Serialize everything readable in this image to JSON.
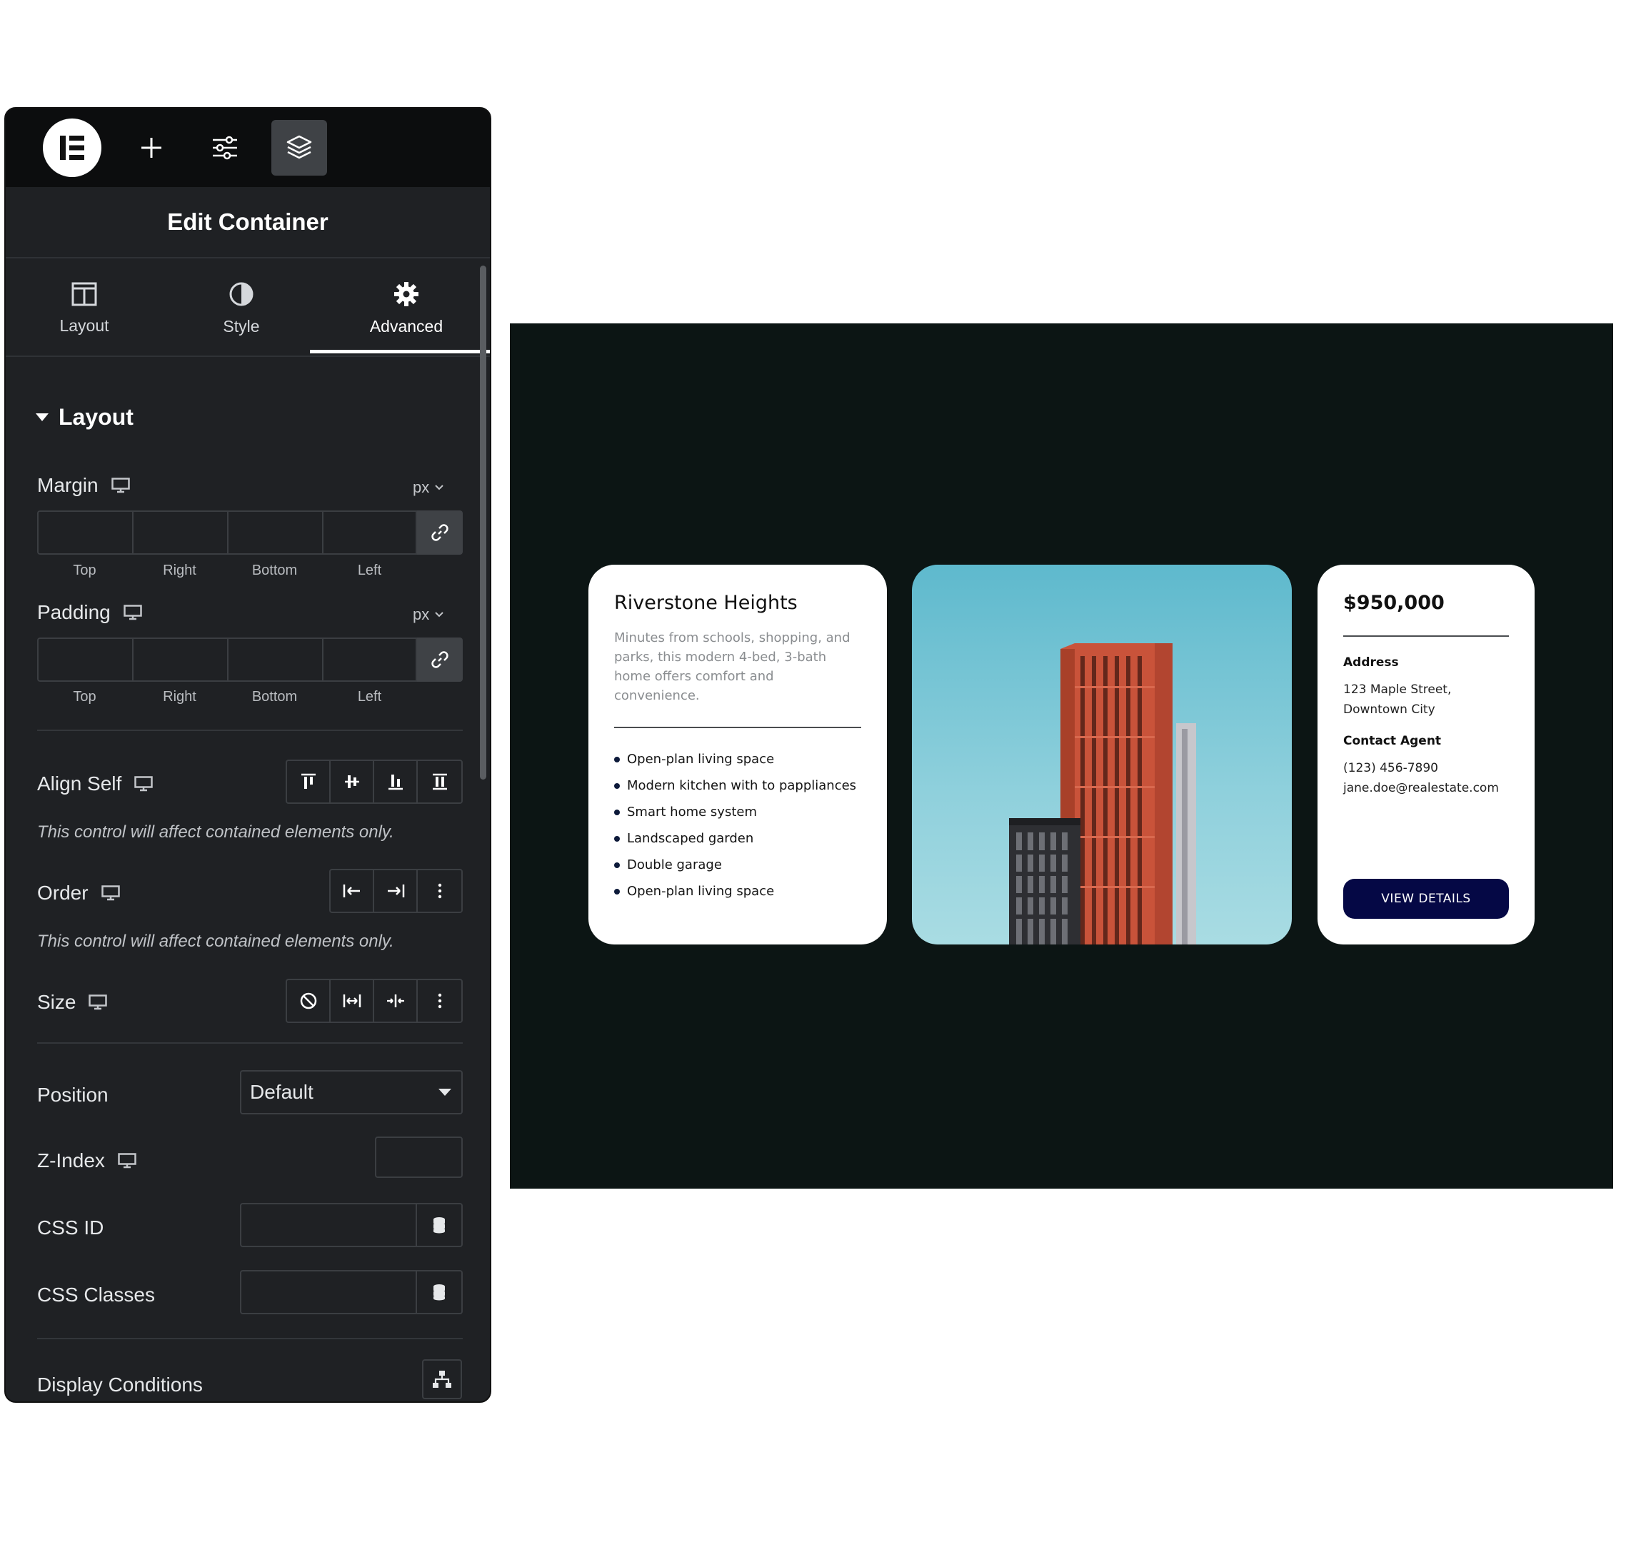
{
  "toolbar": {
    "items": [
      "elementor-logo",
      "add-element",
      "site-settings",
      "structure"
    ]
  },
  "panel": {
    "title": "Edit Container",
    "tabs": [
      {
        "label": "Layout",
        "icon": "columns-icon"
      },
      {
        "label": "Style",
        "icon": "contrast-icon"
      },
      {
        "label": "Advanced",
        "icon": "gear-icon"
      }
    ],
    "active_tab": "Advanced",
    "section": "Layout",
    "margin": {
      "label": "Margin",
      "unit": "px",
      "sides": [
        "Top",
        "Right",
        "Bottom",
        "Left"
      ]
    },
    "padding": {
      "label": "Padding",
      "unit": "px",
      "sides": [
        "Top",
        "Right",
        "Bottom",
        "Left"
      ]
    },
    "align_self": {
      "label": "Align Self",
      "hint": "This control will affect contained elements only."
    },
    "order": {
      "label": "Order",
      "hint": "This control will affect contained elements only."
    },
    "size": {
      "label": "Size"
    },
    "position": {
      "label": "Position",
      "value": "Default"
    },
    "z_index": {
      "label": "Z-Index",
      "value": ""
    },
    "css_id": {
      "label": "CSS ID",
      "value": ""
    },
    "css_classes": {
      "label": "CSS Classes",
      "value": ""
    },
    "display_conditions": {
      "label": "Display Conditions"
    }
  },
  "preview": {
    "left_card": {
      "title": "Riverstone Heights",
      "description": "Minutes from schools, shopping, and parks, this modern 4-bed, 3-bath home offers comfort and convenience.",
      "features": [
        "Open-plan living space",
        "Modern kitchen with to pappliances",
        "Smart home system",
        "Landscaped garden",
        "Double garage",
        "Open-plan living space"
      ]
    },
    "right_card": {
      "price": "$950,000",
      "address_label": "Address",
      "address_line1": "123 Maple Street,",
      "address_line2": "Downtown City",
      "agent_label": "Contact Agent",
      "agent_phone": "(123) 456-7890",
      "agent_email": "jane.doe@realestate.com",
      "button": "VIEW DETAILS"
    }
  },
  "colors": {
    "panel_bg": "#1f2124",
    "topbar_bg": "#0c0d0e",
    "preview_bg": "#0c1514",
    "button_bg": "#050845",
    "building": "#c9533a"
  }
}
